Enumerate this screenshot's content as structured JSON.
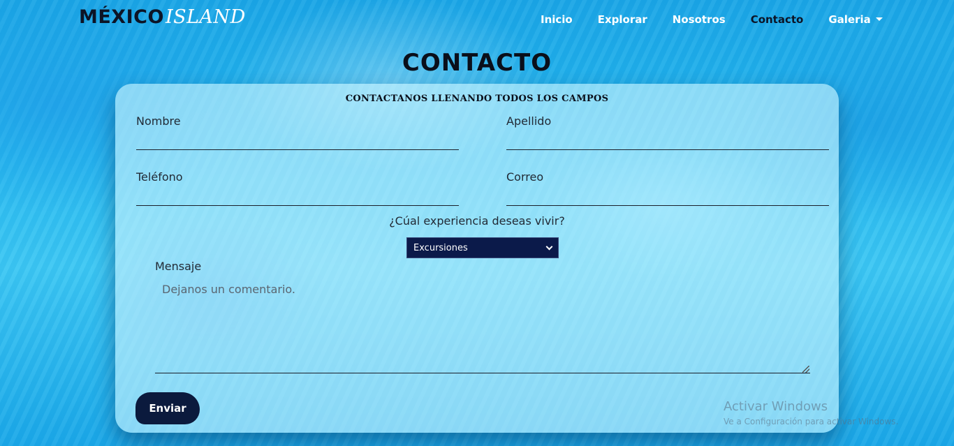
{
  "brand": {
    "main": "MÉXICO",
    "sub": "ISLAND"
  },
  "nav": {
    "items": [
      {
        "label": "Inicio"
      },
      {
        "label": "Explorar"
      },
      {
        "label": "Nosotros"
      },
      {
        "label": "Contacto",
        "active": true
      },
      {
        "label": "Galeria",
        "dropdown": true
      }
    ]
  },
  "page": {
    "title": "CONTACTO"
  },
  "form": {
    "heading": "CONTACTANOS LLENANDO TODOS LOS CAMPOS",
    "fields": {
      "nombre": {
        "label": "Nombre",
        "value": ""
      },
      "apellido": {
        "label": "Apellido",
        "value": ""
      },
      "telefono": {
        "label": "Teléfono",
        "value": ""
      },
      "correo": {
        "label": "Correo",
        "value": ""
      }
    },
    "experience": {
      "question": "¿Cúal experiencia deseas vivir?",
      "selected": "Excursiones"
    },
    "message": {
      "label": "Mensaje",
      "placeholder": "Dejanos un comentario."
    },
    "submit_label": "Enviar"
  },
  "watermark": {
    "title": "Activar Windows",
    "subtitle": "Ve a Configuración para activar Windows."
  },
  "colors": {
    "navy": "#0b1a3d",
    "select_bg": "#0b1a4a",
    "active_nav": "#0c1426",
    "nav_text": "#ffffff"
  }
}
